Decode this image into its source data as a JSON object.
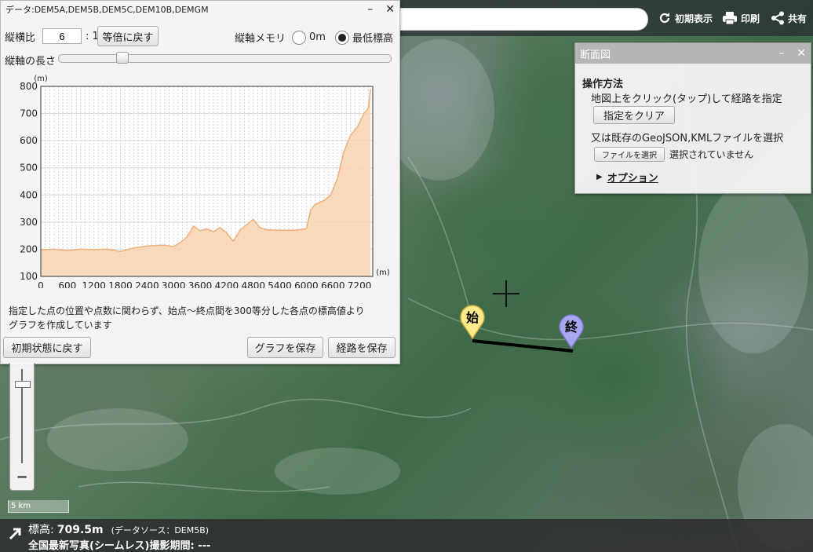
{
  "profile": {
    "title": "データ:DEM5A,DEM5B,DEM5C,DEM10B,DEMGM",
    "aspect_label": "縦横比",
    "aspect_value": "6",
    "aspect_suffix": ": 1",
    "reset_ratio": "等倍に戻す",
    "vertical_memory_label": "縦軸メモリ",
    "opt_zero": "0m",
    "opt_min": "最低標高",
    "length_label": "縦軸の長さ",
    "note_line1": "指定した点の位置や点数に関わらず、始点～終点間を300等分した各点の標高値より",
    "note_line2": "グラフを作成しています",
    "reset_button": "初期状態に戻す",
    "save_graph": "グラフを保存",
    "save_route": "経路を保存",
    "slider_value": 0.18
  },
  "chart_data": {
    "type": "area",
    "ylabel": "(m)",
    "xlabel": "(m)",
    "xlim": [
      0,
      7500
    ],
    "ylim": [
      100,
      800
    ],
    "xticks": [
      0,
      600,
      1200,
      1800,
      2400,
      3000,
      3600,
      4200,
      4800,
      5400,
      6000,
      6600,
      7200
    ],
    "yticks": [
      100,
      200,
      300,
      400,
      500,
      600,
      700,
      800
    ],
    "grid": true,
    "colors": {
      "fill": "#f9d4b0",
      "line": "#eeb07a"
    },
    "x": [
      0,
      300,
      600,
      900,
      1200,
      1500,
      1800,
      2100,
      2400,
      2600,
      2800,
      3000,
      3150,
      3300,
      3450,
      3600,
      3750,
      3900,
      4050,
      4200,
      4350,
      4500,
      4650,
      4800,
      4950,
      5100,
      5400,
      5700,
      6000,
      6100,
      6200,
      6400,
      6550,
      6700,
      6850,
      7000,
      7150,
      7300,
      7400,
      7450
    ],
    "y": [
      198,
      200,
      195,
      200,
      198,
      200,
      192,
      205,
      212,
      214,
      215,
      210,
      225,
      245,
      285,
      268,
      275,
      265,
      280,
      260,
      230,
      270,
      290,
      310,
      280,
      272,
      270,
      270,
      275,
      345,
      365,
      380,
      400,
      460,
      560,
      620,
      650,
      700,
      720,
      790
    ]
  },
  "cross_section": {
    "title": "断面図",
    "ops_heading": "操作方法",
    "instruction": "地図上をクリック(タップ)して経路を指定",
    "clear_button": "指定をクリア",
    "or_text": "又は既存のGeoJSON,KMLファイルを選択",
    "file_button": "ファイルを選択",
    "file_status": "選択されていません",
    "options_link": "オプション"
  },
  "toolbar": {
    "initial_view": "初期表示",
    "print": "印刷",
    "share": "共有"
  },
  "markers": {
    "start": "始",
    "end": "終"
  },
  "scale": "5 km",
  "zoom_out": "−",
  "status": {
    "elevation_label": "標高:",
    "elevation_value": "709.5m",
    "data_source": "(データソース：DEM5B)",
    "photo_info": "全国最新写真(シームレス)撮影期間: ---"
  }
}
